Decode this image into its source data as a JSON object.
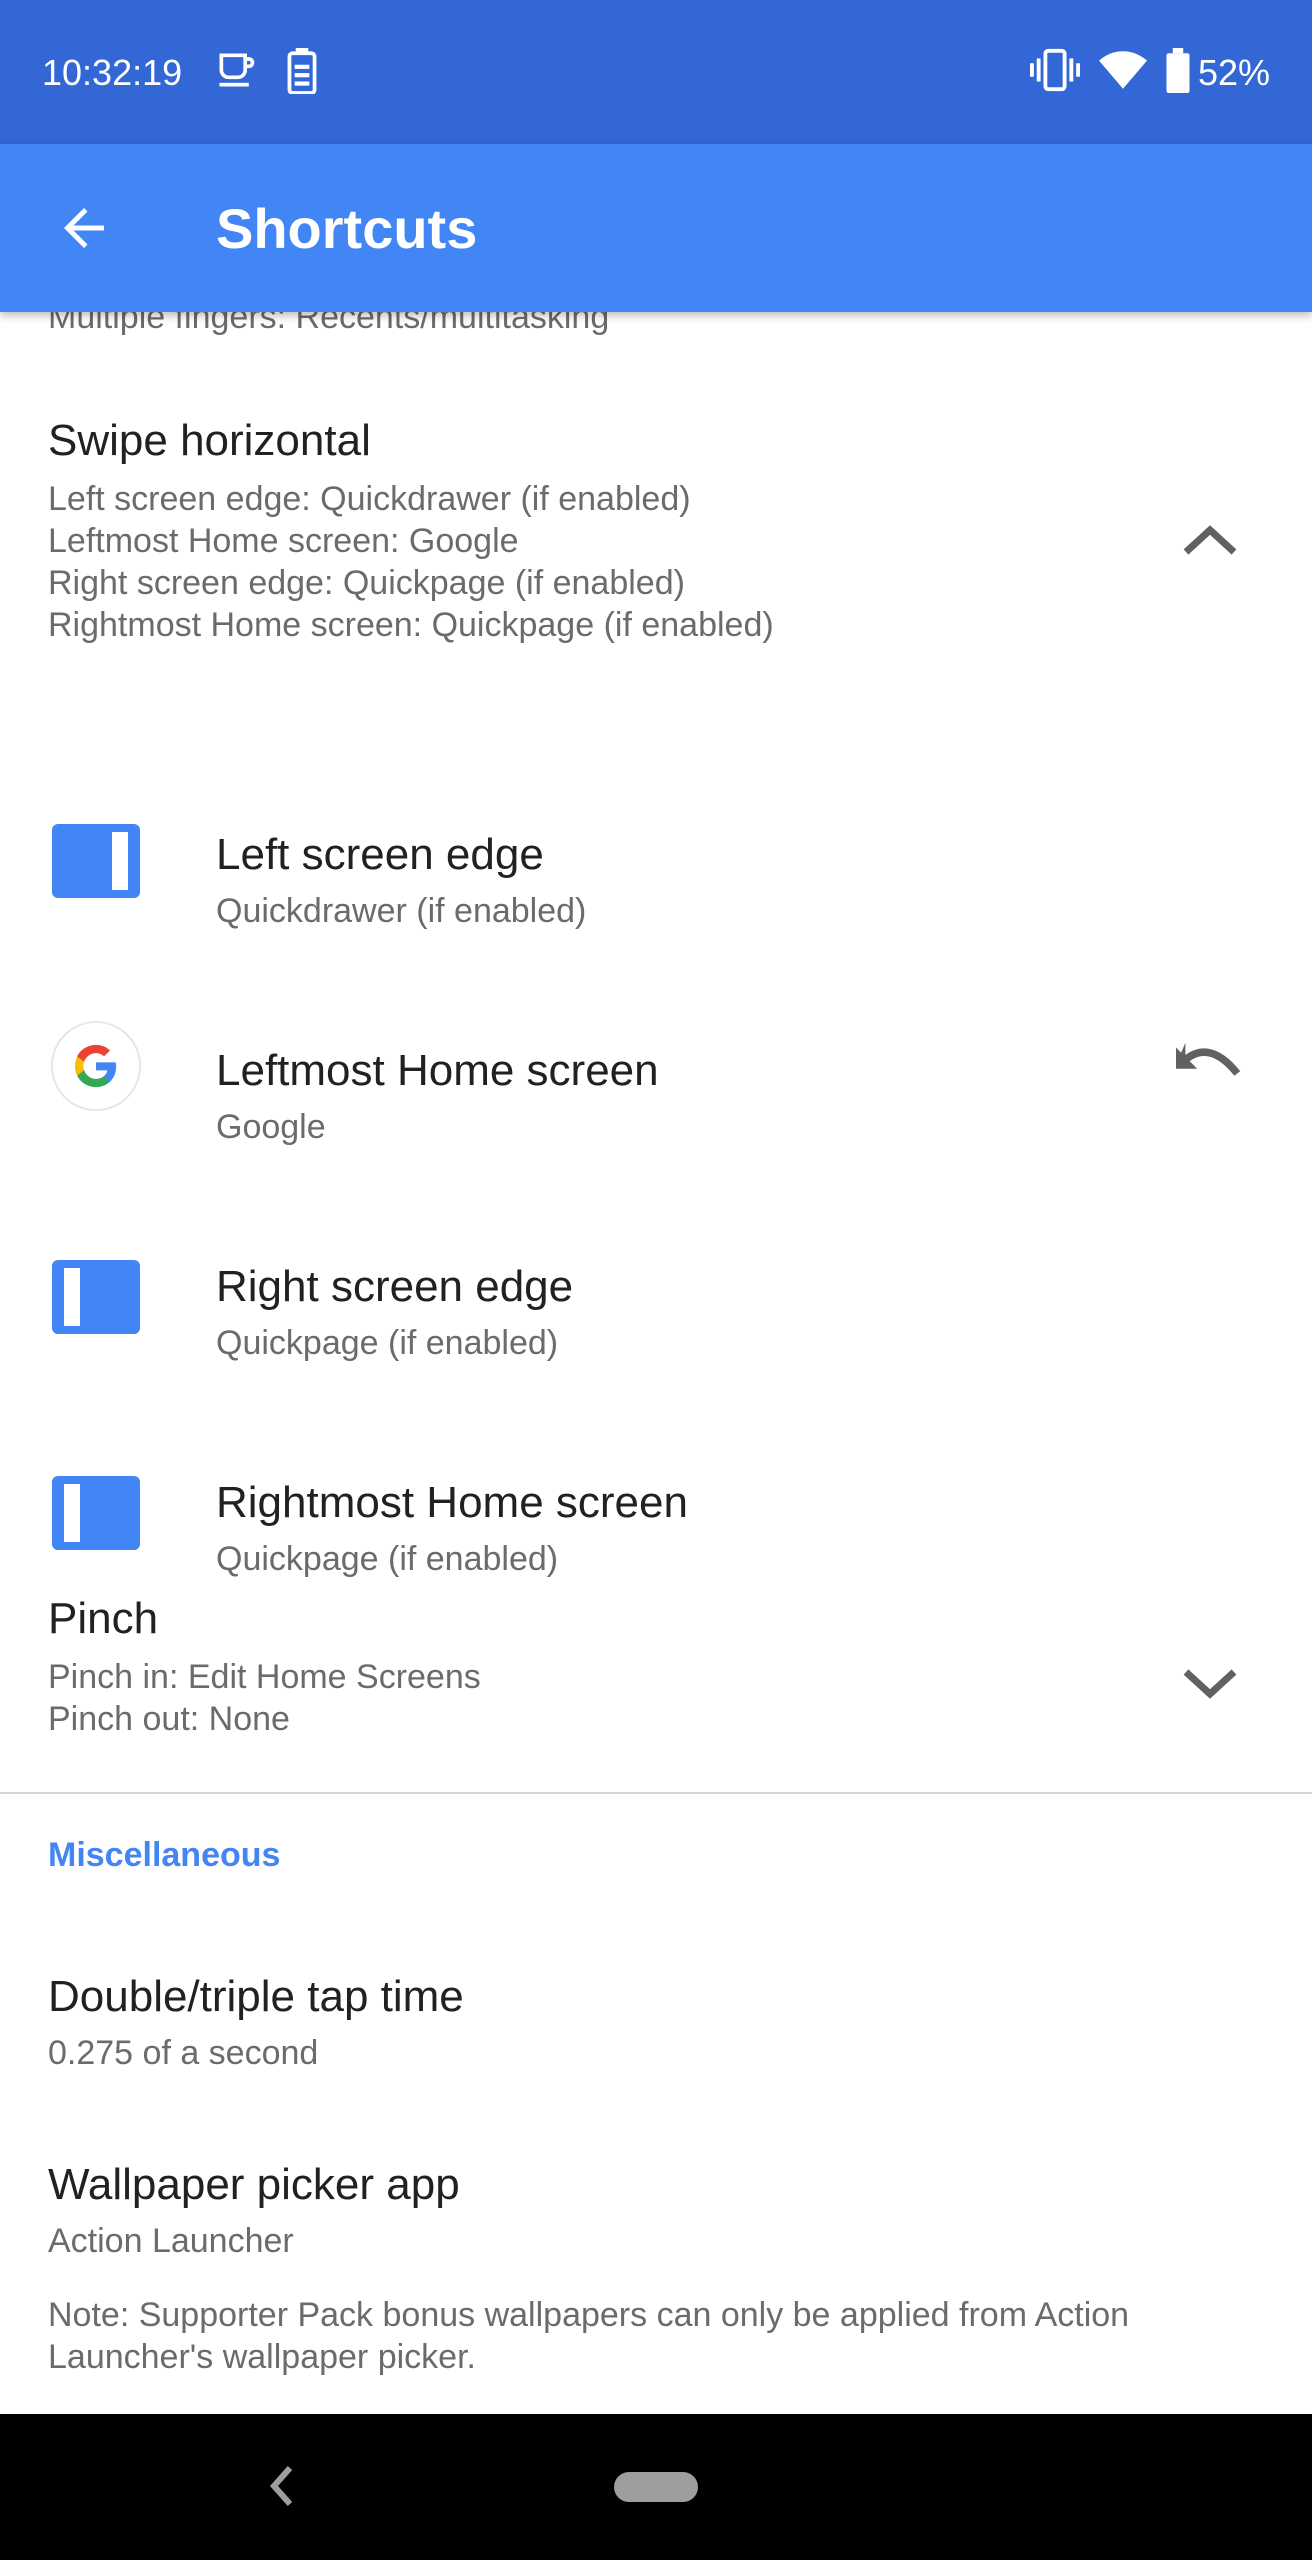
{
  "status_bar": {
    "time": "10:32:19",
    "battery_percent": "52%",
    "icons": [
      "coffee-icon",
      "battery-saver-icon",
      "vibrate-icon",
      "wifi-icon",
      "battery-icon"
    ]
  },
  "app_bar": {
    "title": "Shortcuts",
    "back_icon": "arrow-back-icon"
  },
  "content": {
    "partial_line": "Multiple fingers: Recents/multitasking",
    "swipe_horizontal": {
      "title": "Swipe horizontal",
      "lines": [
        "Left screen edge: Quickdrawer (if enabled)",
        "Leftmost Home screen: Google",
        "Right screen edge: Quickpage (if enabled)",
        "Rightmost Home screen: Quickpage (if enabled)"
      ],
      "toggle_icon": "chevron-up-icon"
    },
    "items": [
      {
        "title": "Left screen edge",
        "subtitle": "Quickdrawer (if enabled)",
        "icon": "panel-right-icon"
      },
      {
        "title": "Leftmost Home screen",
        "subtitle": "Google",
        "icon": "google-icon",
        "action_icon": "undo-icon"
      },
      {
        "title": "Right screen edge",
        "subtitle": "Quickpage (if enabled)",
        "icon": "panel-left-icon"
      },
      {
        "title": "Rightmost Home screen",
        "subtitle": "Quickpage (if enabled)",
        "icon": "panel-left-icon"
      }
    ],
    "pinch": {
      "title": "Pinch",
      "lines": [
        "Pinch in: Edit Home Screens",
        "Pinch out: None"
      ],
      "toggle_icon": "chevron-down-icon"
    },
    "misc": {
      "header": "Miscellaneous",
      "double_tap": {
        "title": "Double/triple tap time",
        "subtitle": "0.275 of a second"
      },
      "wallpaper": {
        "title": "Wallpaper picker app",
        "subtitle": "Action Launcher"
      },
      "note_line1": "Note: Supporter Pack bonus wallpapers can only be applied from Action",
      "note_line2": "Launcher's wallpaper picker."
    }
  },
  "colors": {
    "status_bar": "#3367d6",
    "app_bar": "#4285f4",
    "accent": "#4285f4",
    "primary_text": "#212121",
    "secondary_text": "#6b6b6b"
  }
}
